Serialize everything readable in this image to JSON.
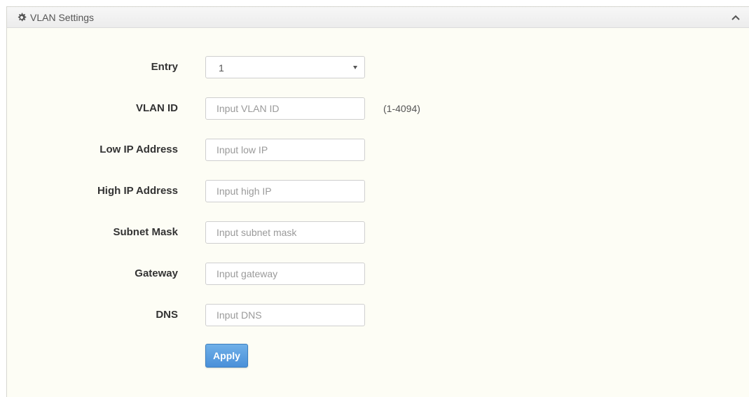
{
  "panel": {
    "title": "VLAN Settings",
    "header_icon": "gear-icon",
    "collapse_icon": "chevron-up-icon"
  },
  "form": {
    "entry": {
      "label": "Entry",
      "value": "1"
    },
    "vlan_id": {
      "label": "VLAN ID",
      "placeholder": "Input VLAN ID",
      "hint": "(1-4094)"
    },
    "low_ip": {
      "label": "Low IP Address",
      "placeholder": "Input low IP"
    },
    "high_ip": {
      "label": "High IP Address",
      "placeholder": "Input high IP"
    },
    "subnet_mask": {
      "label": "Subnet Mask",
      "placeholder": "Input subnet mask"
    },
    "gateway": {
      "label": "Gateway",
      "placeholder": "Input gateway"
    },
    "dns": {
      "label": "DNS",
      "placeholder": "Input DNS"
    },
    "apply_label": "Apply"
  },
  "colors": {
    "panel_background": "#fdfdf5",
    "button_primary": "#4a90d9"
  }
}
